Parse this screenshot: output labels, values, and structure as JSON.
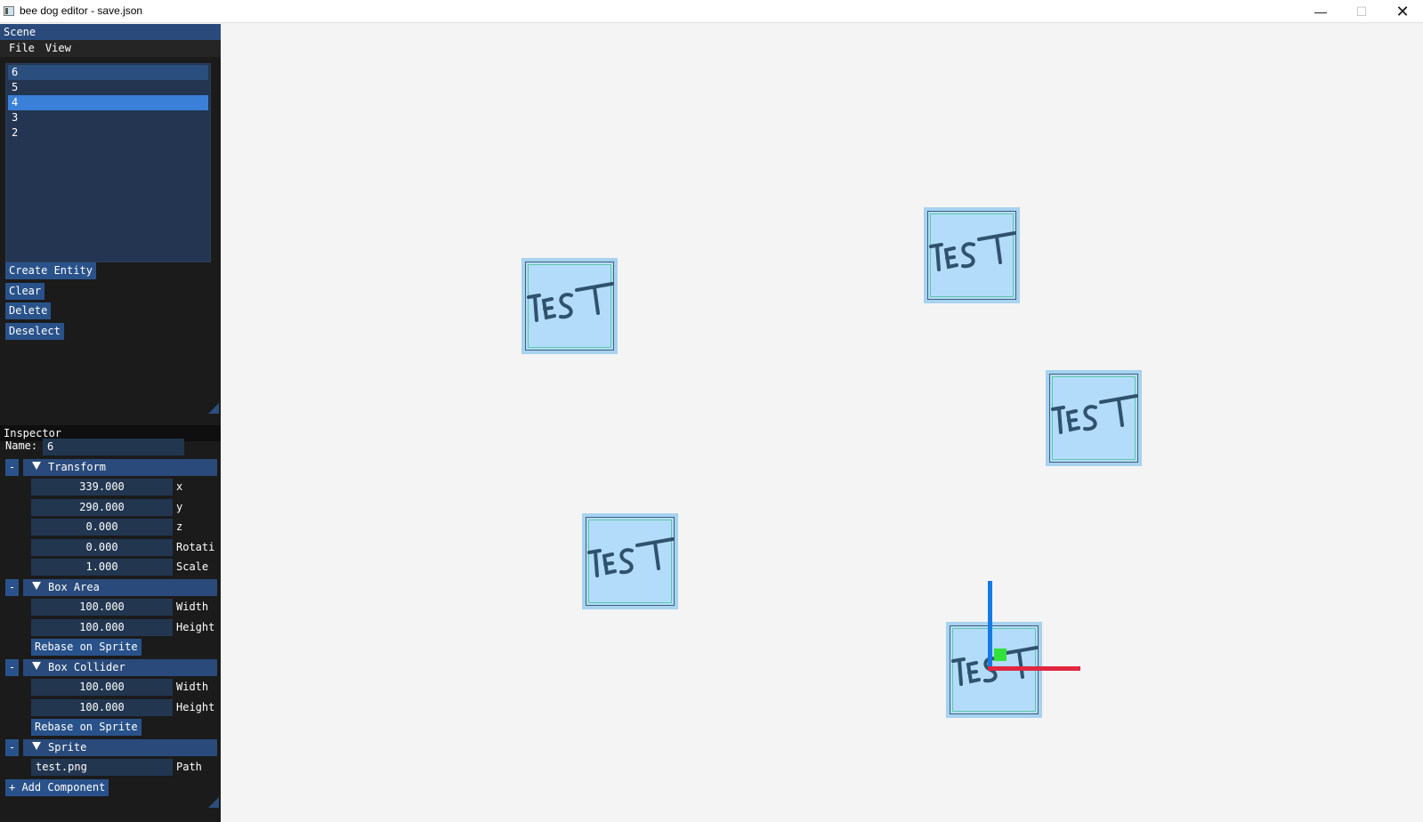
{
  "window": {
    "title": "bee dog editor - save.json",
    "minimize_glyph": "—",
    "maximize_glyph": "☐",
    "close_glyph": "✕"
  },
  "scene_panel": {
    "title": "Scene",
    "menu": [
      "File",
      "View"
    ],
    "entities": [
      "6",
      "5",
      "4",
      "3",
      "2"
    ],
    "selected_entity": "4",
    "buttons": {
      "create": "Create Entity",
      "clear": "Clear",
      "delete": "Delete",
      "deselect": "Deselect"
    }
  },
  "inspector": {
    "title": "Inspector",
    "name_label": "Name:",
    "name_value": "6",
    "collapse_glyph": "-",
    "transform": {
      "header": "Transform",
      "x": "339.000",
      "x_label": "x",
      "y": "290.000",
      "y_label": "y",
      "z": "0.000",
      "z_label": "z",
      "rotation": "0.000",
      "rotation_label": "Rotati",
      "scale": "1.000",
      "scale_label": "Scale"
    },
    "box_area": {
      "header": "Box Area",
      "width": "100.000",
      "width_label": "Width",
      "height": "100.000",
      "height_label": "Height",
      "rebase": "Rebase on Sprite"
    },
    "box_collider": {
      "header": "Box Collider",
      "width": "100.000",
      "width_label": "Width",
      "height": "100.000",
      "height_label": "Height",
      "rebase": "Rebase on Sprite"
    },
    "sprite": {
      "header": "Sprite",
      "path": "test.png",
      "path_label": "Path"
    },
    "add_component": "+ Add Component"
  },
  "viewport": {
    "sprite_text": "TEST",
    "gizmo_colors": {
      "x_axis": "#e12740",
      "y_axis": "#1679e8",
      "center": "#30e23a"
    }
  },
  "colors": {
    "panel_bg": "#1b1b1b",
    "accent": "#294a7a",
    "selected": "#3a7fd8",
    "viewport_bg": "#f4f4f4",
    "sprite_fill": "#b3dcfa"
  }
}
